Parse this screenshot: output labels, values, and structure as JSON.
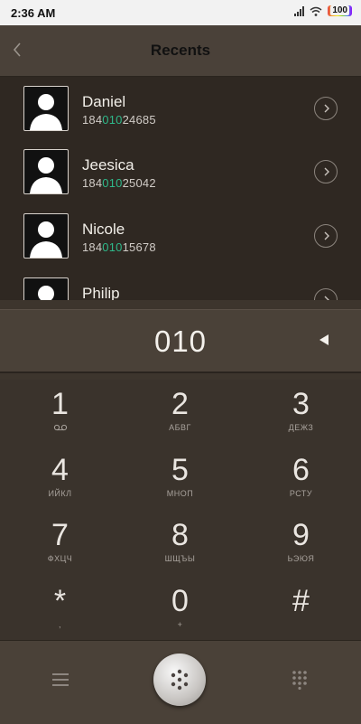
{
  "status_bar": {
    "time": "2:36 AM",
    "battery": "100"
  },
  "header": {
    "title": "Recents"
  },
  "contacts": [
    {
      "name": "Daniel",
      "number_prefix": "184",
      "number_match": "010",
      "number_suffix": "24685"
    },
    {
      "name": "Jeesica",
      "number_prefix": "184",
      "number_match": "010",
      "number_suffix": "25042"
    },
    {
      "name": "Nicole",
      "number_prefix": "184",
      "number_match": "010",
      "number_suffix": "15678"
    },
    {
      "name": "Philip",
      "number_prefix": "",
      "number_match": "",
      "number_suffix": ""
    }
  ],
  "display": {
    "digits": "010"
  },
  "keypad": [
    {
      "digit": "1",
      "letters": ""
    },
    {
      "digit": "2",
      "letters": "АБВГ"
    },
    {
      "digit": "3",
      "letters": "ДЕЖЗ"
    },
    {
      "digit": "4",
      "letters": "ИЙКЛ"
    },
    {
      "digit": "5",
      "letters": "МНОП"
    },
    {
      "digit": "6",
      "letters": "РСТУ"
    },
    {
      "digit": "7",
      "letters": "ФХЦЧ"
    },
    {
      "digit": "8",
      "letters": "ШЩЪЫ"
    },
    {
      "digit": "9",
      "letters": "ЬЭЮЯ"
    },
    {
      "digit": "*",
      "letters": ","
    },
    {
      "digit": "0",
      "letters": "+"
    },
    {
      "digit": "#",
      "letters": ""
    }
  ],
  "colors": {
    "match_highlight": "#2fb88a",
    "background": "#3d352d"
  }
}
